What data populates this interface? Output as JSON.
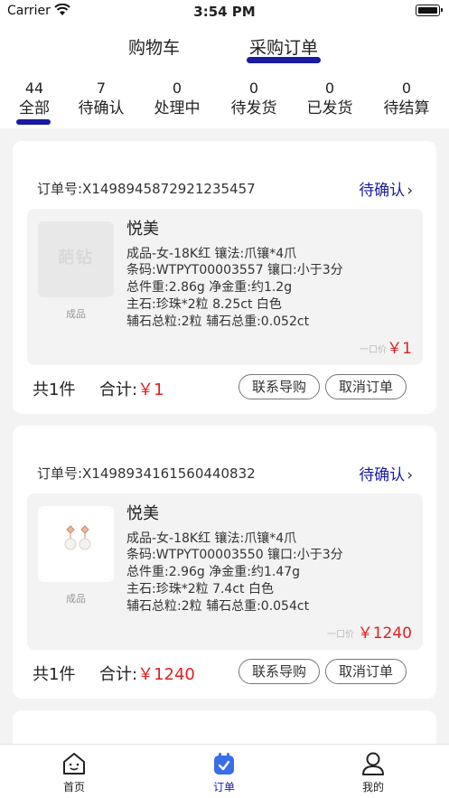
{
  "status_bar": {
    "carrier": "Carrier",
    "time": "3:54 PM"
  },
  "top_tabs": [
    {
      "label": "购物车"
    },
    {
      "label": "采购订单",
      "active": true
    }
  ],
  "status_tabs": [
    {
      "count": "44",
      "label": "全部",
      "active": true
    },
    {
      "count": "7",
      "label": "待确认"
    },
    {
      "count": "0",
      "label": "处理中"
    },
    {
      "count": "0",
      "label": "待发货"
    },
    {
      "count": "0",
      "label": "已发货"
    },
    {
      "count": "0",
      "label": "待结算"
    }
  ],
  "orders": [
    {
      "order_no": "订单号:X1498945872921235457",
      "status": "待确认",
      "item": {
        "name": "悦美",
        "thumb_watermark": "葩钻",
        "thumb_label": "成品",
        "lines": [
          "成品-女-18K红 镶法:爪镶*4爪",
          "条码:WTPYT00003557 镶口:小于3分",
          "总件重:2.86g 净金重:约1.2g",
          "主石:珍珠*2粒 8.25ct 白色",
          "辅石总粒:2粒 辅石总重:0.052ct"
        ],
        "unit_label": "一口价",
        "unit_price": "￥1"
      },
      "count": "共1件",
      "total_label": "合计:",
      "total": "￥1",
      "buttons": {
        "contact": "联系导购",
        "cancel": "取消订单"
      }
    },
    {
      "order_no": "订单号:X1498934161560440832",
      "status": "待确认",
      "item": {
        "name": "悦美",
        "thumb_label": "成品",
        "lines": [
          "成品-女-18K红 镶法:爪镶*4爪",
          "条码:WTPYT00003550 镶口:小于3分",
          "总件重:2.96g 净金重:约1.47g",
          "主石:珍珠*2粒 7.4ct 白色",
          "辅石总粒:2粒 辅石总重:0.054ct"
        ],
        "unit_label": "一口价",
        "unit_price": "￥1240"
      },
      "count": "共1件",
      "total_label": "合计:",
      "total": "￥1240",
      "buttons": {
        "contact": "联系导购",
        "cancel": "取消订单"
      }
    }
  ],
  "tab_bar": [
    {
      "label": "首页",
      "icon": "home-icon"
    },
    {
      "label": "订单",
      "icon": "orders-icon",
      "active": true
    },
    {
      "label": "我的",
      "icon": "profile-icon"
    }
  ],
  "colors": {
    "accent": "#1a1ba0",
    "price": "#e02020",
    "background": "#f3f3f3"
  }
}
